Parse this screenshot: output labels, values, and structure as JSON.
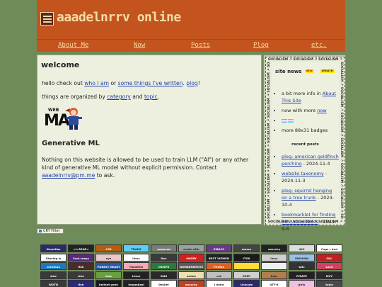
{
  "header": {
    "title": "aaadelnrrv online"
  },
  "nav": [
    {
      "label": "About Me"
    },
    {
      "label": "Now"
    },
    {
      "label": "Posts"
    },
    {
      "label": "Plog"
    },
    {
      "label": "etc."
    }
  ],
  "main": {
    "heading": "welcome",
    "intro": {
      "t1": "hello check out ",
      "link_who": "who I am",
      "t2": " or ",
      "link_written": "some things I've written",
      "t3": ". ",
      "link_plog": "plog",
      "t4": "!"
    },
    "organized": {
      "t1": "things are organized by ",
      "link_category": "category",
      "t2": " and ",
      "link_topic": "topic",
      "t3": "."
    },
    "webma": {
      "w": "WEB",
      "ma": "MA"
    },
    "genml": {
      "heading": "Generative ML",
      "text": "Nothing on this website is allowed to be used to train LLM (\"AI\") or any other kind of generative ML model without explicit permission. Contact ",
      "email": "aaadelnrrv@pm.me",
      "end": " to ask."
    }
  },
  "sidebar": {
    "ribbon": "SOCIALISM ☭ SOCIALISM ☭ SOCIALISM ☭",
    "ribbon_long": "SOCIALISM ☭ SOCIALISM ☭ SOCIALISM ☭ SOCIALISM ☭ SOCIALISM ☭ SOCIALISM ☭ SOCIALISM ☭",
    "site_news": "site news",
    "badge_new": "NEW!",
    "badge_update": "UPDATE!",
    "news": {
      "n1_text": "a bit more info in ",
      "n1_link": "About This Site",
      "n2_text": "now with more ",
      "n2_link": "now",
      "n4_text": "more 88x31 badges"
    },
    "recent_title": "recent posts",
    "recent": [
      {
        "title": "plog: american goldfinch perching",
        "date": " - 2024-11-4"
      },
      {
        "title": "website taxonomy",
        "date": " - 2024-11-3"
      },
      {
        "title": "plog: squirrel hanging on a tree trunk",
        "date": " - 2024-10-4"
      },
      {
        "title": "bookmarklet for finding RSS/Atom feeds",
        "date": " - 2024-9-6"
      }
    ]
  },
  "crt": {
    "label": "CRT Filter"
  },
  "badges": [
    {
      "label": "Neocities",
      "color": "#2a2a6a"
    },
    {
      "label": "<I<3EAR>",
      "color": "#222222"
    },
    {
      "label": "CSS",
      "color": "#b85c10"
    },
    {
      "label": "TRANS",
      "color": "#5bcefa"
    },
    {
      "label": "powered",
      "color": "#7a7a7a"
    },
    {
      "label": "made with",
      "color": "#9aa0a0"
    },
    {
      "label": "EMACS",
      "color": "#6a3a8a"
    },
    {
      "label": "emacs",
      "color": "#444444"
    },
    {
      "label": "anarchy",
      "color": "#222222"
    },
    {
      "label": "490",
      "color": "#dddddd"
    },
    {
      "label": "Cops r bad",
      "color": "#ffffff"
    },
    {
      "label": "Sharing is",
      "color": "#ffffff"
    },
    {
      "label": "Soul.reaps",
      "color": "#5a2a7a"
    },
    {
      "label": "eye",
      "color": "#e8c8c8"
    },
    {
      "label": "linux",
      "color": "#ffffff"
    },
    {
      "label": "Dev",
      "color": "#3a3a3a"
    },
    {
      "label": "ANGRY",
      "color": "#d02020"
    },
    {
      "label": "BEST VIEWED",
      "color": "#222222"
    },
    {
      "label": "ITOX",
      "color": "#1a1a1a"
    },
    {
      "label": "linux",
      "color": "#d0d0d0"
    },
    {
      "label": "FASHION",
      "color": "#9ac0e0"
    },
    {
      "label": "SQL",
      "color": "#c02020"
    },
    {
      "label": "archinux",
      "color": "#1a7ac0"
    },
    {
      "label": "fish",
      "color": "#4a2a2a"
    },
    {
      "label": "PUREST HEART",
      "color": "#2a5aa0"
    },
    {
      "label": "Transfem",
      "color": "#f5a9b8"
    },
    {
      "label": "CRISPR",
      "color": "#2a7a3a"
    },
    {
      "label": "NUMBEREMOTE",
      "color": "#5a5a5a"
    },
    {
      "label": "Firefox",
      "color": "#e06020"
    },
    {
      "label": "",
      "color": "#ffdd33"
    },
    {
      "label": "",
      "color": "#f0f0f0"
    },
    {
      "label": "w3c",
      "color": "#333333"
    },
    {
      "label": "Love",
      "color": "#d04060"
    },
    {
      "label": "zine",
      "color": "#3a3a3a"
    },
    {
      "label": "zine",
      "color": "#3a3a3a"
    },
    {
      "label": "tree",
      "color": "#6aa040"
    },
    {
      "label": "Linux",
      "color": "#222222"
    },
    {
      "label": "GNU",
      "color": "#2a2a2a"
    },
    {
      "label": "anime",
      "color": "#f0e0b0"
    },
    {
      "label": "cat",
      "color": "#c0c0c0"
    },
    {
      "label": "KEEP",
      "color": "#d0d0d0"
    },
    {
      "label": "bear",
      "color": "#b08050"
    },
    {
      "label": "PIRATE",
      "color": "#222222"
    },
    {
      "label": "MVY",
      "color": "#2a2a2a"
    },
    {
      "label": "WOTD",
      "color": "#3a3a3a"
    },
    {
      "label": "fish",
      "color": "#2a2a7a"
    },
    {
      "label": "hellnet.work",
      "color": "#1a1a1a"
    },
    {
      "label": "hmpmbasi",
      "color": "#222222"
    },
    {
      "label": "Decker",
      "color": "#ffffff"
    },
    {
      "label": "anarchy",
      "color": "#c04020"
    },
    {
      "label": "I mind",
      "color": "#ffffff"
    },
    {
      "label": "Unicode",
      "color": "#2a2a6a"
    },
    {
      "label": "UTF-8",
      "color": "#ffffff"
    },
    {
      "label": "girly",
      "color": "#f0c0e0"
    },
    {
      "label": "tools",
      "color": "#4a4a4a"
    },
    {
      "label": "bee",
      "color": "#222222"
    }
  ]
}
